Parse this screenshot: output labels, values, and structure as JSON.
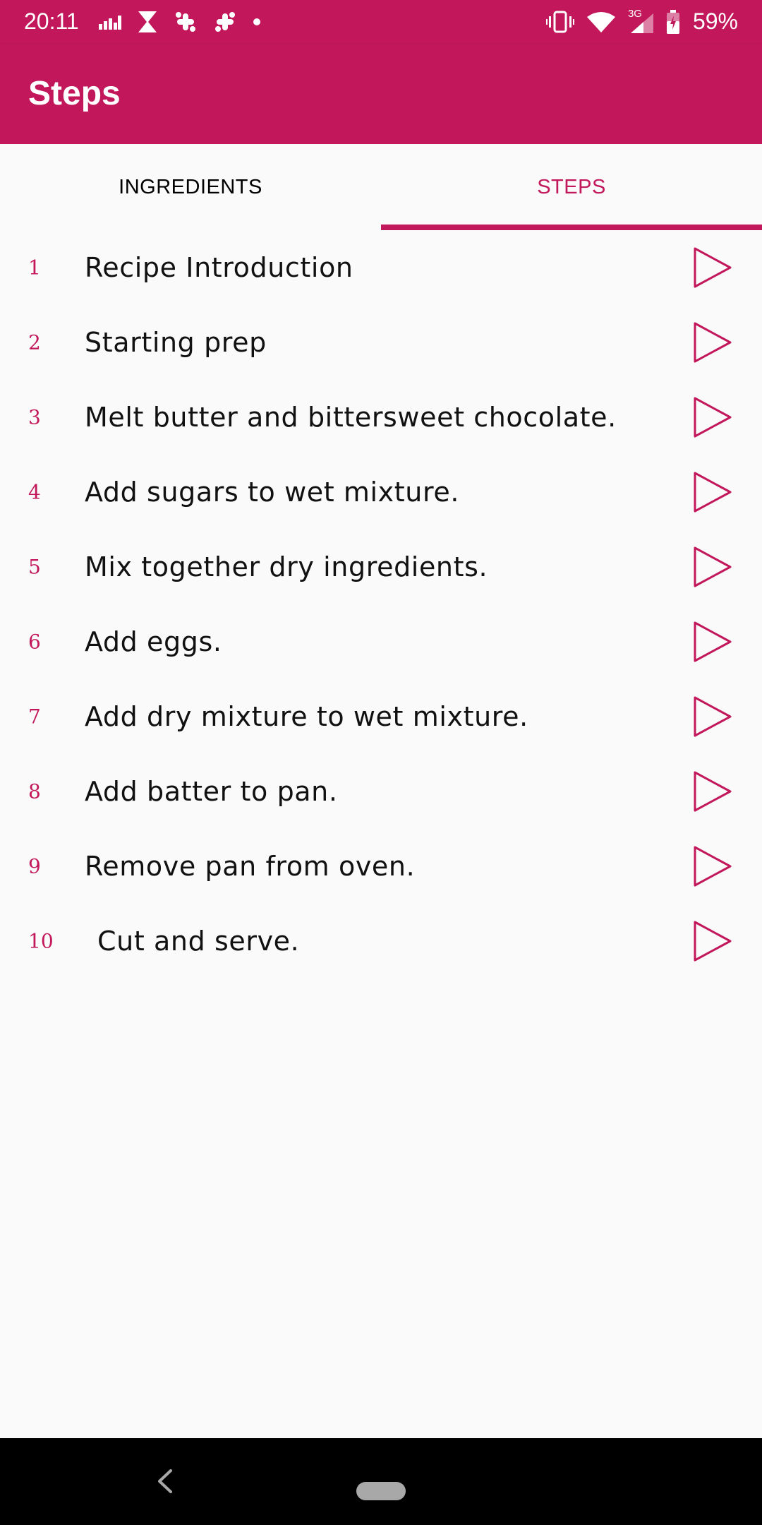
{
  "colors": {
    "primary": "#c2185b",
    "background": "#fafafa",
    "text": "#111111",
    "nav_bar": "#000000"
  },
  "status_bar": {
    "time": "20:11",
    "battery": "59%",
    "network": "3G",
    "left_icons": [
      "signal-bars-icon",
      "hourglass-icon",
      "slack-icon",
      "slack-icon",
      "dot-icon"
    ],
    "right_icons": [
      "vibrate-icon",
      "wifi-icon",
      "cell-signal-icon",
      "battery-icon"
    ]
  },
  "app_bar": {
    "title": "Steps"
  },
  "tabs": [
    {
      "label": "INGREDIENTS",
      "selected": false
    },
    {
      "label": "STEPS",
      "selected": true
    }
  ],
  "steps": [
    {
      "number": "1",
      "title": "Recipe Introduction"
    },
    {
      "number": "2",
      "title": "Starting prep"
    },
    {
      "number": "3",
      "title": "Melt butter and bittersweet chocolate."
    },
    {
      "number": "4",
      "title": "Add sugars to wet mixture."
    },
    {
      "number": "5",
      "title": "Mix together dry ingredients."
    },
    {
      "number": "6",
      "title": "Add eggs."
    },
    {
      "number": "7",
      "title": "Add dry mixture to wet mixture."
    },
    {
      "number": "8",
      "title": "Add batter to pan."
    },
    {
      "number": "9",
      "title": "Remove pan from oven."
    },
    {
      "number": "10",
      "title": "Cut and serve."
    }
  ],
  "nav_bar": {
    "icons": [
      "back-icon",
      "home-pill-icon"
    ]
  }
}
